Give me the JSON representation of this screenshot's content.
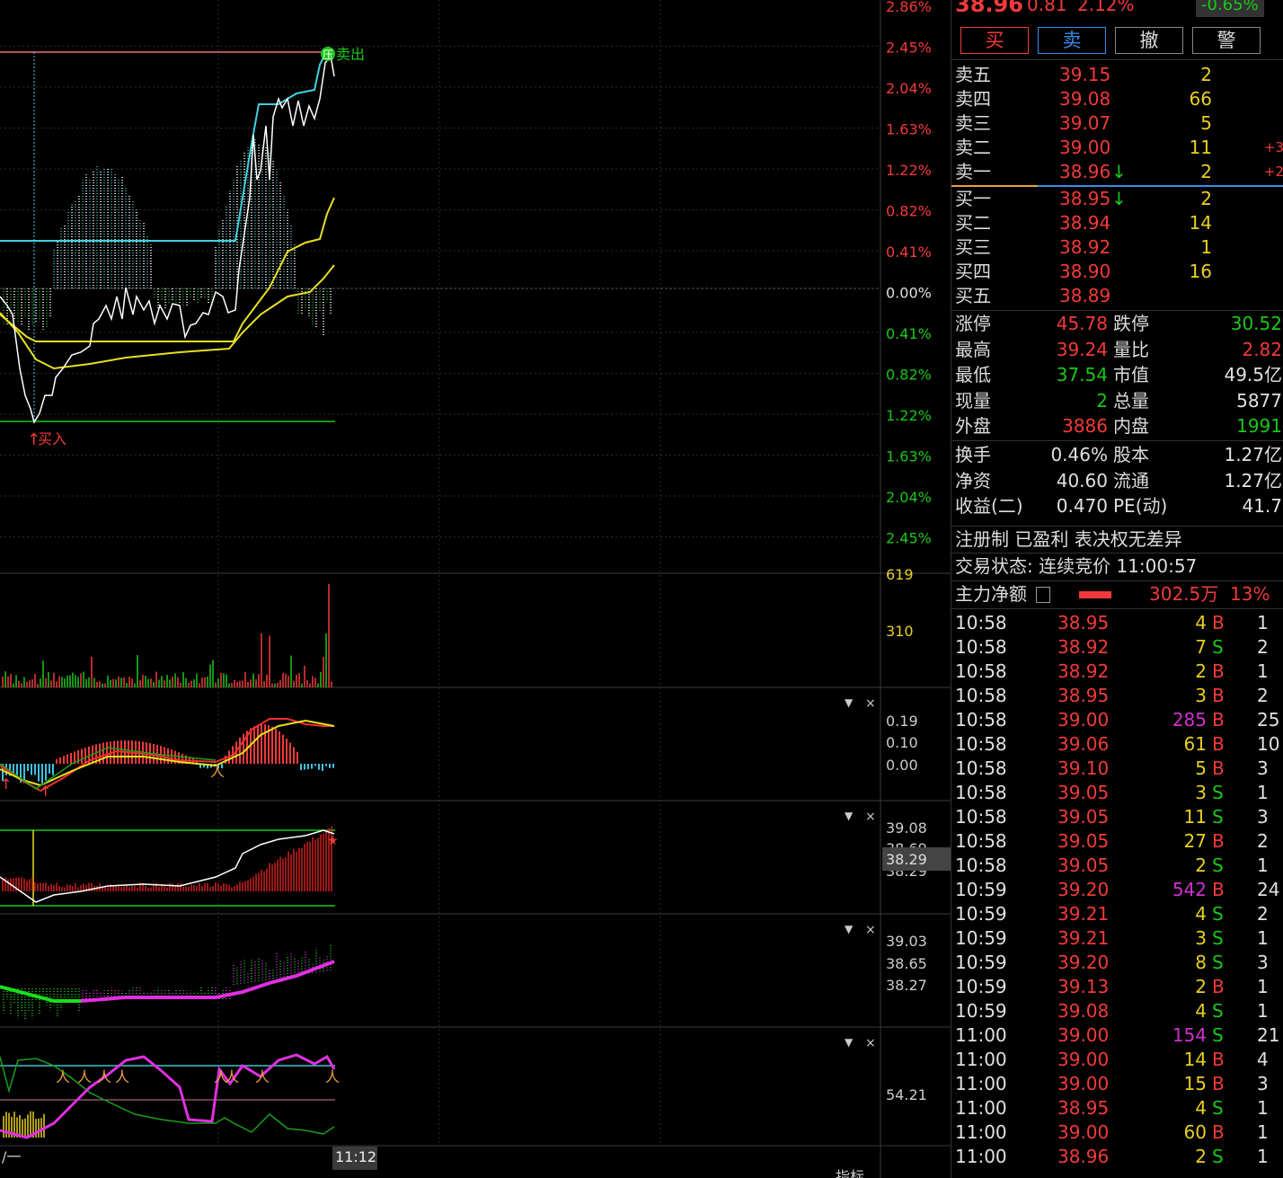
{
  "header": {
    "price": "38.96",
    "change": "0.81",
    "pct": "2.12%",
    "badge": "-0.65%"
  },
  "buttons": [
    "买",
    "卖",
    "撤",
    "警"
  ],
  "orderbook": {
    "asks": [
      {
        "label": "卖五",
        "price": "39.15",
        "vol": "2",
        "delta": ""
      },
      {
        "label": "卖四",
        "price": "39.08",
        "vol": "66",
        "delta": ""
      },
      {
        "label": "卖三",
        "price": "39.07",
        "vol": "5",
        "delta": ""
      },
      {
        "label": "卖二",
        "price": "39.00",
        "vol": "11",
        "delta": "+3"
      },
      {
        "label": "卖一",
        "price": "38.96",
        "vol": "2",
        "delta": "+2",
        "arrow": "down"
      }
    ],
    "bids": [
      {
        "label": "买一",
        "price": "38.95",
        "vol": "2",
        "arrow": "down"
      },
      {
        "label": "买二",
        "price": "38.94",
        "vol": "14"
      },
      {
        "label": "买三",
        "price": "38.92",
        "vol": "1"
      },
      {
        "label": "买四",
        "price": "38.90",
        "vol": "16"
      },
      {
        "label": "买五",
        "price": "38.89",
        "vol": ""
      }
    ]
  },
  "stats": [
    {
      "l1": "涨停",
      "v1": "45.78",
      "c1": "red",
      "l2": "跌停",
      "v2": "30.52",
      "c2": "grn"
    },
    {
      "l1": "最高",
      "v1": "39.24",
      "c1": "red",
      "l2": "量比",
      "v2": "2.82",
      "c2": "red"
    },
    {
      "l1": "最低",
      "v1": "37.54",
      "c1": "grn",
      "l2": "市值",
      "v2": "49.5亿",
      "c2": "wht"
    },
    {
      "l1": "现量",
      "v1": "2",
      "c1": "grn",
      "l2": "总量",
      "v2": "5877",
      "c2": "wht"
    },
    {
      "l1": "外盘",
      "v1": "3886",
      "c1": "red",
      "l2": "内盘",
      "v2": "1991",
      "c2": "grn"
    }
  ],
  "stats2": [
    {
      "l1": "换手",
      "v1": "0.46%",
      "l2": "股本",
      "v2": "1.27亿"
    },
    {
      "l1": "净资",
      "v1": "40.60",
      "l2": "流通",
      "v2": "1.27亿"
    },
    {
      "l1": "收益(二)",
      "v1": "0.470",
      "l2": "PE(动)",
      "v2": "41.7"
    }
  ],
  "tags": "注册制 已盈利 表决权无差异",
  "trade_status": "交易状态: 连续竞价 11:00:57",
  "main_force": {
    "label": "主力净额",
    "value": "302.5万",
    "pct": "13%"
  },
  "ticks": [
    {
      "t": "10:58",
      "p": "38.95",
      "v": "4",
      "vc": "yel",
      "s": "B",
      "n": "1"
    },
    {
      "t": "10:58",
      "p": "38.92",
      "v": "7",
      "vc": "yel",
      "s": "S",
      "n": "2"
    },
    {
      "t": "10:58",
      "p": "38.92",
      "v": "2",
      "vc": "yel",
      "s": "B",
      "n": "1"
    },
    {
      "t": "10:58",
      "p": "38.95",
      "v": "3",
      "vc": "yel",
      "s": "B",
      "n": "2"
    },
    {
      "t": "10:58",
      "p": "39.00",
      "v": "285",
      "vc": "mag",
      "s": "B",
      "n": "25"
    },
    {
      "t": "10:58",
      "p": "39.06",
      "v": "61",
      "vc": "yel",
      "s": "B",
      "n": "10"
    },
    {
      "t": "10:58",
      "p": "39.10",
      "v": "5",
      "vc": "yel",
      "s": "B",
      "n": "3"
    },
    {
      "t": "10:58",
      "p": "39.05",
      "v": "3",
      "vc": "yel",
      "s": "S",
      "n": "1"
    },
    {
      "t": "10:58",
      "p": "39.05",
      "v": "11",
      "vc": "yel",
      "s": "S",
      "n": "3"
    },
    {
      "t": "10:58",
      "p": "39.05",
      "v": "27",
      "vc": "yel",
      "s": "B",
      "n": "2"
    },
    {
      "t": "10:58",
      "p": "39.05",
      "v": "2",
      "vc": "yel",
      "s": "S",
      "n": "1"
    },
    {
      "t": "10:59",
      "p": "39.20",
      "v": "542",
      "vc": "mag",
      "s": "B",
      "n": "24"
    },
    {
      "t": "10:59",
      "p": "39.21",
      "v": "4",
      "vc": "yel",
      "s": "S",
      "n": "2"
    },
    {
      "t": "10:59",
      "p": "39.21",
      "v": "3",
      "vc": "yel",
      "s": "S",
      "n": "1"
    },
    {
      "t": "10:59",
      "p": "39.20",
      "v": "8",
      "vc": "yel",
      "s": "S",
      "n": "3"
    },
    {
      "t": "10:59",
      "p": "39.13",
      "v": "2",
      "vc": "yel",
      "s": "B",
      "n": "1"
    },
    {
      "t": "10:59",
      "p": "39.08",
      "v": "4",
      "vc": "yel",
      "s": "S",
      "n": "1"
    },
    {
      "t": "11:00",
      "p": "39.00",
      "v": "154",
      "vc": "mag",
      "s": "S",
      "n": "21"
    },
    {
      "t": "11:00",
      "p": "39.00",
      "v": "14",
      "vc": "yel",
      "s": "B",
      "n": "4"
    },
    {
      "t": "11:00",
      "p": "39.00",
      "v": "15",
      "vc": "yel",
      "s": "B",
      "n": "3"
    },
    {
      "t": "11:00",
      "p": "38.95",
      "v": "4",
      "vc": "yel",
      "s": "S",
      "n": "1"
    },
    {
      "t": "11:00",
      "p": "39.00",
      "v": "60",
      "vc": "yel",
      "s": "B",
      "n": "1"
    },
    {
      "t": "11:00",
      "p": "38.96",
      "v": "2",
      "vc": "yel",
      "s": "S",
      "n": "1"
    }
  ],
  "chart": {
    "price_axis": [
      {
        "v": "2.86%",
        "c": "red"
      },
      {
        "v": "2.45%",
        "c": "red"
      },
      {
        "v": "2.04%",
        "c": "red"
      },
      {
        "v": "1.63%",
        "c": "red"
      },
      {
        "v": "1.22%",
        "c": "red"
      },
      {
        "v": "0.82%",
        "c": "red"
      },
      {
        "v": "0.41%",
        "c": "red"
      },
      {
        "v": "0.00%",
        "c": "wht"
      },
      {
        "v": "0.41%",
        "c": "grn"
      },
      {
        "v": "0.82%",
        "c": "grn"
      },
      {
        "v": "1.22%",
        "c": "grn"
      },
      {
        "v": "1.63%",
        "c": "grn"
      },
      {
        "v": "2.04%",
        "c": "grn"
      },
      {
        "v": "2.45%",
        "c": "grn"
      }
    ],
    "volume_axis": [
      "619",
      "310"
    ],
    "macd_axis": [
      "0.19",
      "0.10",
      "0.00"
    ],
    "ind2_axis": [
      "39.08",
      "38.69",
      "38.29"
    ],
    "ind2_price": "38.29",
    "ind3_axis": [
      "39.03",
      "38.65",
      "38.27"
    ],
    "ind4_axis": [
      "54.21"
    ],
    "sell_label": "卖出",
    "sell_badge": "压",
    "buy_label": "买入",
    "time_label": "11:12",
    "bottom_left": "/一",
    "bottom_right": "指标"
  }
}
